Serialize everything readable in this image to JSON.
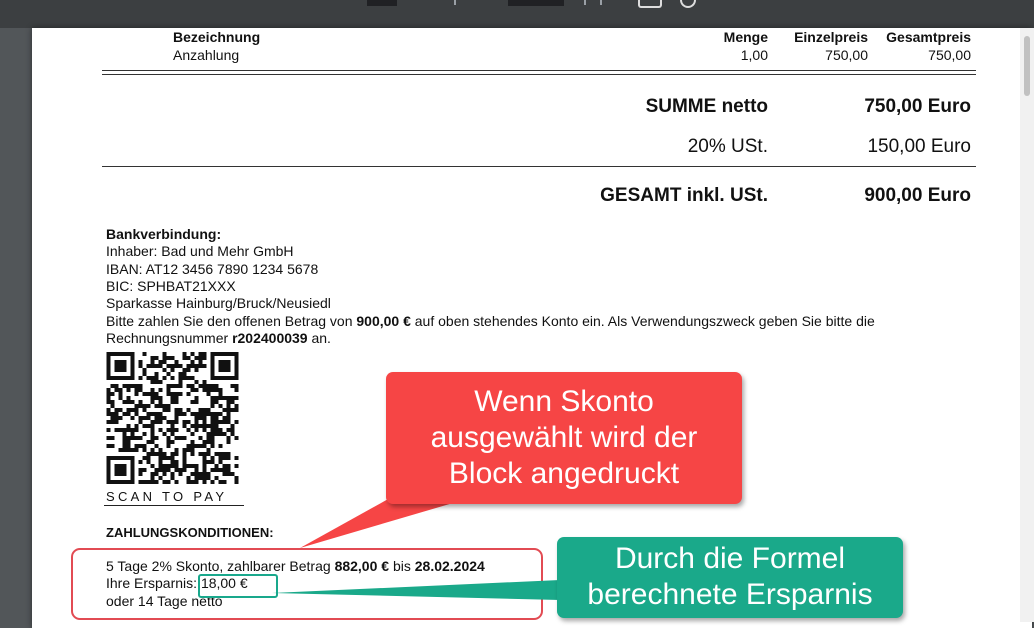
{
  "table": {
    "header": {
      "bezeichnung": "Bezeichnung",
      "menge": "Menge",
      "einzelpreis": "Einzelpreis",
      "gesamtpreis": "Gesamtpreis"
    },
    "row": {
      "bezeichnung": "Anzahlung",
      "menge": "1,00",
      "einzelpreis": "750,00",
      "gesamtpreis": "750,00"
    }
  },
  "totals": {
    "summe_label": "SUMME netto",
    "summe_value": "750,00 Euro",
    "ust_label": "20% USt.",
    "ust_value": "150,00 Euro",
    "gesamt_label": "GESAMT inkl. USt.",
    "gesamt_value": "900,00 Euro"
  },
  "bank": {
    "title": "Bankverbindung:",
    "inhaber": "Inhaber: Bad und Mehr GmbH",
    "iban": "IBAN: AT12 3456 7890 1234 5678",
    "bic": "BIC: SPHBAT21XXX",
    "bank_name": "Sparkasse Hainburg/Bruck/Neusiedl",
    "pay_text_1": "Bitte zahlen Sie den offenen Betrag von ",
    "pay_amount": "900,00 €",
    "pay_text_2": " auf oben stehendes Konto ein. Als Verwendungszweck geben Sie bitte die",
    "pay_text_3": "Rechnungsnummer ",
    "invoice_number": "r202400039",
    "pay_text_4": " an."
  },
  "qr": {
    "caption": "SCAN TO PAY"
  },
  "conditions": {
    "title": "ZAHLUNGSKONDITIONEN:",
    "line1_a": "5 Tage 2% Skonto, zahlbarer Betrag ",
    "line1_amount": "882,00 €",
    "line1_b": " bis ",
    "line1_date": "28.02.2024",
    "line2_label": "Ihre Ersparnis: ",
    "line2_value": "18,00 €",
    "line3": "oder 14 Tage netto"
  },
  "callouts": {
    "red_line1": "Wenn Skonto",
    "red_line2": "ausgewählt wird der",
    "red_line3": "Block angedruckt",
    "green_line1": "Durch die Formel",
    "green_line2": "berechnete Ersparnis"
  },
  "colors": {
    "red_callout": "#f64545",
    "green_callout": "#1aa98a",
    "viewer_bg": "#525659"
  }
}
